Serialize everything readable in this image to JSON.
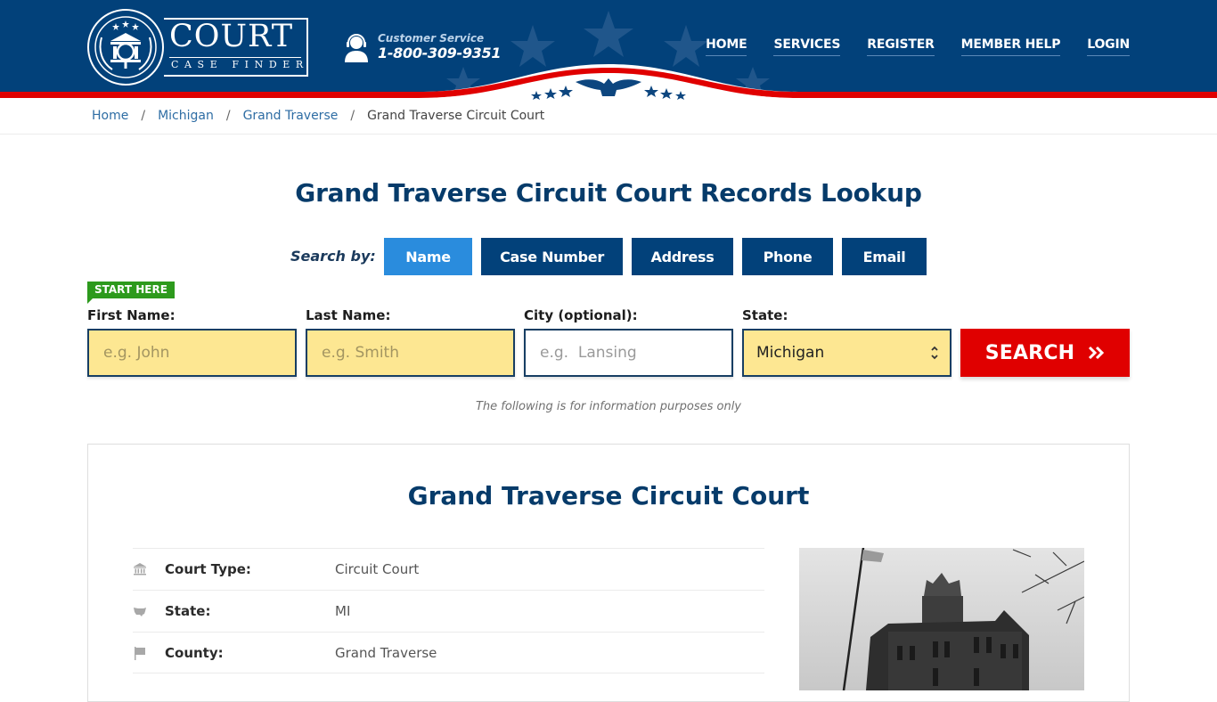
{
  "header": {
    "logo": {
      "title": "COURT",
      "subtitle": "CASE FINDER"
    },
    "customer_service": {
      "label": "Customer Service",
      "phone": "1-800-309-9351"
    },
    "nav": [
      {
        "label": "HOME"
      },
      {
        "label": "SERVICES"
      },
      {
        "label": "REGISTER"
      },
      {
        "label": "MEMBER HELP"
      },
      {
        "label": "LOGIN"
      }
    ],
    "colors": {
      "primary": "#02417a",
      "accent_red": "#e00000"
    }
  },
  "breadcrumb": [
    {
      "label": "Home",
      "link": true
    },
    {
      "label": "Michigan",
      "link": true
    },
    {
      "label": "Grand Traverse",
      "link": true
    },
    {
      "label": "Grand Traverse Circuit Court",
      "link": false
    }
  ],
  "page_title": "Grand Traverse Circuit Court Records Lookup",
  "search": {
    "search_by_label": "Search by:",
    "tabs": [
      {
        "label": "Name",
        "active": true
      },
      {
        "label": "Case Number",
        "active": false
      },
      {
        "label": "Address",
        "active": false
      },
      {
        "label": "Phone",
        "active": false
      },
      {
        "label": "Email",
        "active": false
      }
    ],
    "start_here": "START HERE",
    "fields": {
      "first_name": {
        "label": "First Name:",
        "placeholder": "e.g. John",
        "value": ""
      },
      "last_name": {
        "label": "Last Name:",
        "placeholder": "e.g. Smith",
        "value": ""
      },
      "city": {
        "label": "City (optional):",
        "placeholder": "e.g.  Lansing",
        "value": ""
      },
      "state": {
        "label": "State:",
        "selected": "Michigan"
      }
    },
    "search_button": "SEARCH",
    "search_button_icon": "double-chevron-right-icon",
    "disclaimer": "The following is for information purposes only"
  },
  "court": {
    "title": "Grand Traverse Circuit Court",
    "info": [
      {
        "icon": "courthouse-icon",
        "key": "Court Type:",
        "value": "Circuit Court"
      },
      {
        "icon": "usa-map-icon",
        "key": "State:",
        "value": "MI"
      },
      {
        "icon": "flag-icon",
        "key": "County:",
        "value": "Grand Traverse"
      }
    ],
    "image_alt": "Grand Traverse Circuit Court building"
  }
}
